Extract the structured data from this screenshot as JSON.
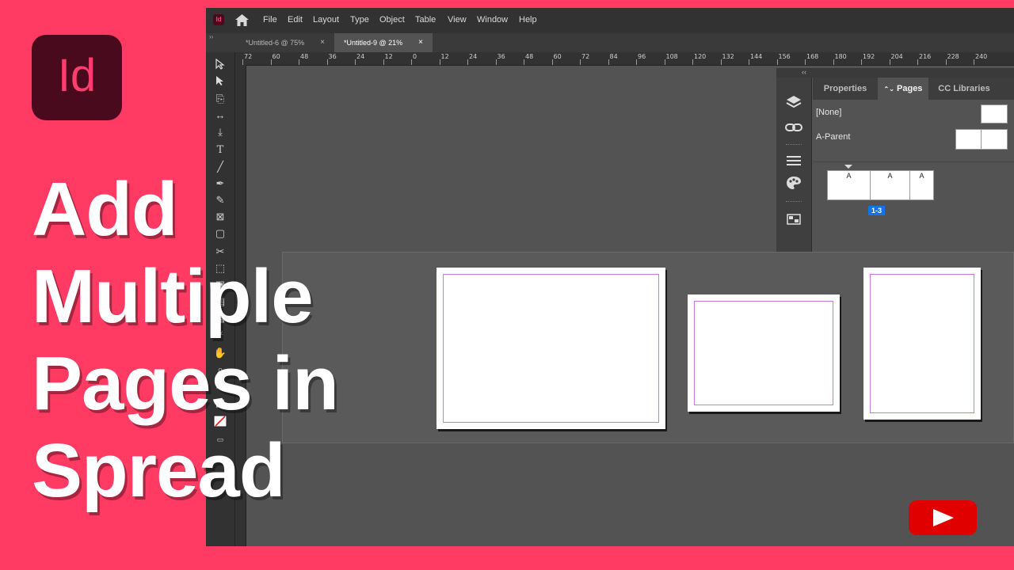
{
  "app": {
    "logo_text": "Id",
    "icon_name": "indesign-logo-icon",
    "brand_color": "#ff3366"
  },
  "menu": [
    "File",
    "Edit",
    "Layout",
    "Type",
    "Object",
    "Table",
    "View",
    "Window",
    "Help"
  ],
  "doc_tabs": [
    {
      "label": "*Untitled-6 @ 75%",
      "active": false
    },
    {
      "label": "*Untitled-9 @ 21%",
      "active": true
    }
  ],
  "tab_close": "×",
  "ruler_labels": [
    "72",
    "60",
    "48",
    "36",
    "24",
    "12",
    "0",
    "12",
    "24",
    "36",
    "48",
    "60",
    "72",
    "84",
    "96",
    "108",
    "120",
    "132",
    "144",
    "156",
    "168",
    "180",
    "192",
    "204",
    "216",
    "228",
    "240"
  ],
  "panel": {
    "collapse_glyph": "‹‹",
    "tabs": [
      {
        "label": "Properties",
        "active": false
      },
      {
        "label": "Pages",
        "active": true,
        "prefix": "⌃⌄"
      },
      {
        "label": "CC Libraries",
        "active": false
      }
    ],
    "parents": [
      {
        "label": "[None]"
      },
      {
        "label": "A-Parent"
      }
    ],
    "page_labels": [
      "A",
      "A",
      "A"
    ],
    "spread_badge": "1-3",
    "strip_icons": [
      "layers-icon",
      "links-icon",
      "stroke-icon",
      "swatches-icon",
      "pages-grid-icon"
    ]
  },
  "overlay": {
    "title_lines": [
      "Add",
      "Multiple",
      "Pages in",
      "Spread"
    ],
    "youtube_icon": "youtube-play-icon"
  },
  "colors": {
    "background": "#ff3b63",
    "margin_guide": "#c77be0",
    "badge": "#1473e6",
    "youtube": "#e00000"
  }
}
